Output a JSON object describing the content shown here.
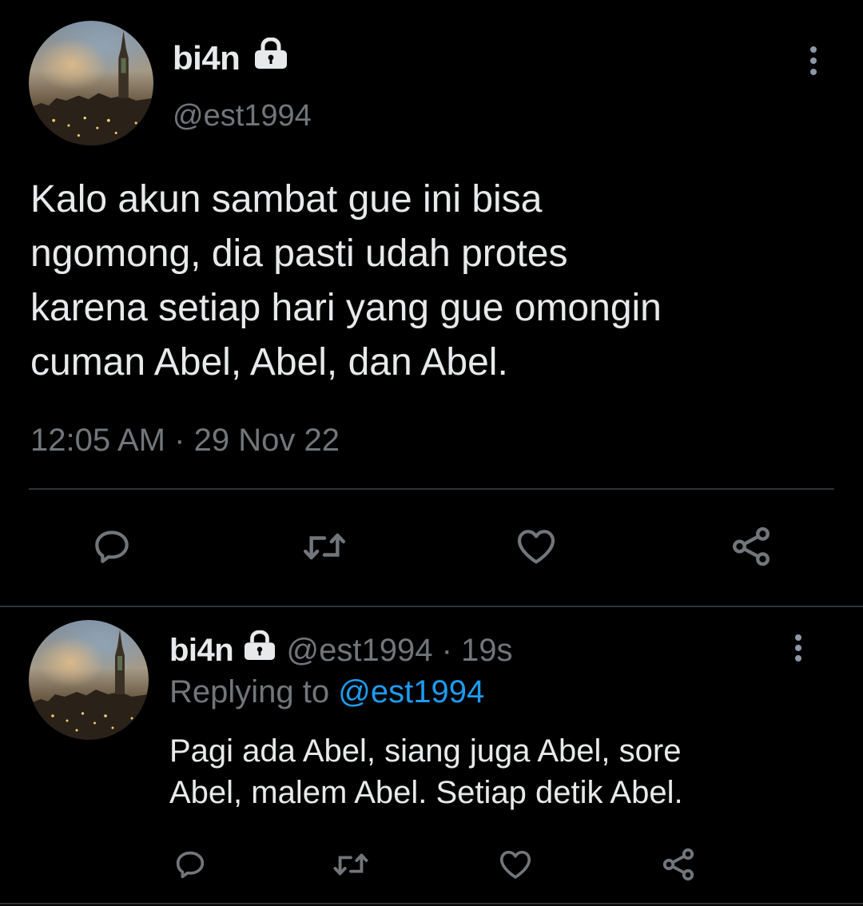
{
  "main_tweet": {
    "display_name": "bi4n",
    "handle": "@est1994",
    "text_lines": [
      "Kalo akun sambat gue ini bisa",
      "ngomong, dia pasti udah protes",
      "karena setiap hari yang gue omongin",
      "cuman Abel, Abel, dan Abel."
    ],
    "time": "12:05 AM",
    "separator": "·",
    "date": "29 Nov 22"
  },
  "reply_tweet": {
    "display_name": "bi4n",
    "handle": "@est1994",
    "separator": "·",
    "age": "19s",
    "replying_prefix": "Replying to",
    "replying_handle": "@est1994",
    "text_lines": [
      "Pagi ada Abel, siang juga Abel, sore",
      "Abel, malem Abel. Setiap detik Abel."
    ]
  },
  "icons": {
    "more": "more-vertical-icon",
    "lock": "lock-icon",
    "reply": "reply-icon",
    "retweet": "retweet-icon",
    "like": "heart-icon",
    "share": "share-icon"
  },
  "colors": {
    "background": "#000000",
    "text": "#e7e9ea",
    "muted": "#71767b",
    "accent": "#1d9bf0",
    "divider": "#2f3336"
  }
}
